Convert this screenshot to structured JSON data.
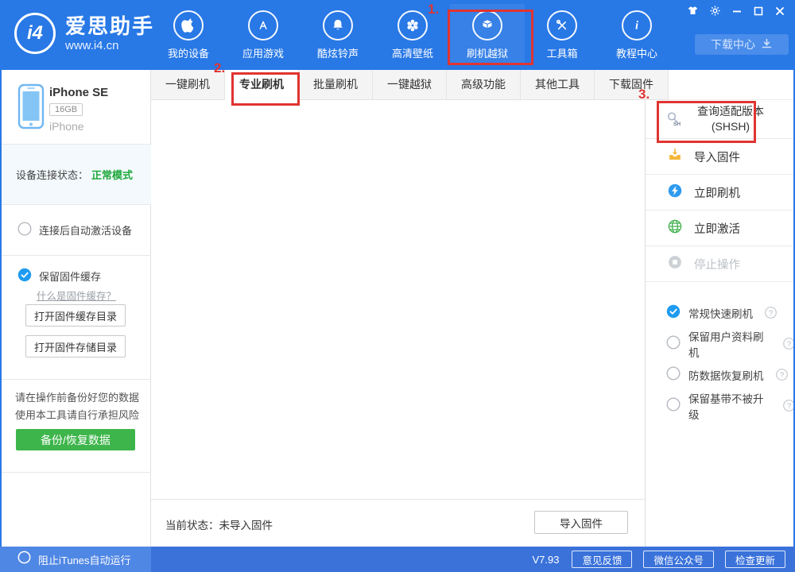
{
  "header": {
    "logo_mark": "i4",
    "logo_title": "爱思助手",
    "logo_subtitle": "www.i4.cn",
    "nav_items": [
      {
        "label": "我的设备",
        "icon": "apple-icon"
      },
      {
        "label": "应用游戏",
        "icon": "appstore-icon"
      },
      {
        "label": "酷炫铃声",
        "icon": "bell-icon"
      },
      {
        "label": "高清壁纸",
        "icon": "flower-icon"
      },
      {
        "label": "刷机越狱",
        "icon": "package-icon",
        "highlighted": true
      },
      {
        "label": "工具箱",
        "icon": "tools-icon"
      },
      {
        "label": "教程中心",
        "icon": "info-icon"
      }
    ],
    "download_center_label": "下载中心",
    "window_control_icons": [
      "theme-skin-icon",
      "settings-gear-icon",
      "minimize-icon",
      "maximize-icon",
      "close-icon"
    ]
  },
  "tabbar": {
    "tabs": [
      {
        "label": "一键刷机"
      },
      {
        "label": "专业刷机",
        "active": true,
        "highlighted": true
      },
      {
        "label": "批量刷机"
      },
      {
        "label": "一键越狱"
      },
      {
        "label": "高级功能"
      },
      {
        "label": "其他工具"
      },
      {
        "label": "下载固件"
      }
    ]
  },
  "left_sidebar": {
    "device": {
      "name": "iPhone SE",
      "capacity": "16GB",
      "family": "iPhone"
    },
    "connection": {
      "label": "设备连接状态：",
      "status": "正常模式"
    },
    "auto_activate_label": "连接后自动激活设备",
    "auto_activate_checked": false,
    "firmware_cache": {
      "checkbox_label": "保留固件缓存",
      "checked": true,
      "help_link": "什么是固件缓存？",
      "open_cache_button": "打开固件缓存目录",
      "open_storage_button": "打开固件存储目录"
    },
    "warning_lines": [
      "请在操作前备份好您的数据",
      "使用本工具请自行承担风险"
    ],
    "backup_button": "备份/恢复数据"
  },
  "right_sidebar": {
    "actions": [
      {
        "label": "查询适配版本",
        "sublabel": "(SHSH)",
        "icon": "shsh-search-icon",
        "highlighted": true
      },
      {
        "label": "导入固件",
        "icon": "import-firmware-icon"
      },
      {
        "label": "立即刷机",
        "icon": "flash-device-icon"
      },
      {
        "label": "立即激活",
        "icon": "activate-globe-icon"
      },
      {
        "label": "停止操作",
        "icon": "stop-icon",
        "disabled": true
      }
    ],
    "flash_modes": [
      {
        "label": "常规快速刷机",
        "selected": true
      },
      {
        "label": "保留用户资料刷机",
        "selected": false
      },
      {
        "label": "防数据恢复刷机",
        "selected": false
      },
      {
        "label": "保留基带不被升级",
        "selected": false
      }
    ]
  },
  "status_row": {
    "label": "当前状态：未导入固件",
    "import_button": "导入固件"
  },
  "footer": {
    "itunes_block_label": "阻止iTunes自动运行",
    "itunes_block_checked": false,
    "version": "V7.93",
    "buttons": [
      {
        "label": "意见反馈"
      },
      {
        "label": "微信公众号"
      },
      {
        "label": "检查更新"
      }
    ]
  },
  "annotations": {
    "step1": "1.",
    "step2": "2.",
    "step3": "3."
  },
  "colors": {
    "header_blue": "#2878e6",
    "footer_blue": "#3a72da",
    "footer_left_blue": "#4f87e4",
    "annotation_red": "#e03431",
    "status_green": "#1fa83c",
    "backup_green": "#3db54a",
    "check_blue": "#1e9bf0",
    "icon_yellow": "#f4b73b",
    "icon_blue": "#2f9bef",
    "icon_green": "#41b14d"
  }
}
